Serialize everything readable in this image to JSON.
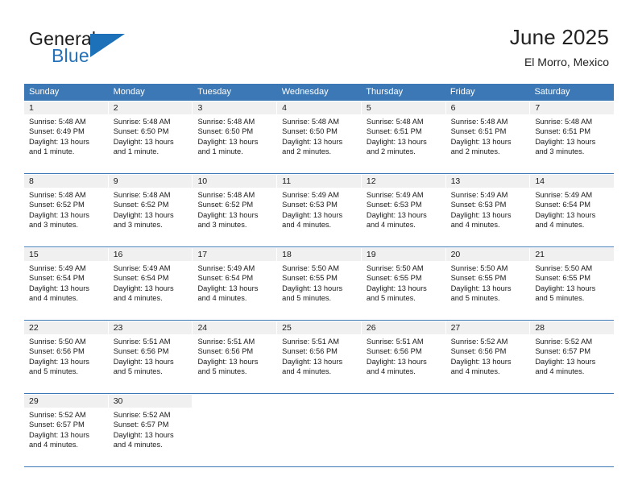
{
  "brand": {
    "word1": "General",
    "word2": "Blue",
    "triangle_color": "#1d71b8",
    "word1_color": "#1a1a1a",
    "word2_color": "#2572b8",
    "icon": "triangle-right-icon"
  },
  "header": {
    "title": "June 2025",
    "subtitle": "El Morro, Mexico"
  },
  "theme": {
    "header_blue": "#3b78b5",
    "daynum_bg": "#f0f0f0",
    "text": "#1a1a1a"
  },
  "weekdays": [
    "Sunday",
    "Monday",
    "Tuesday",
    "Wednesday",
    "Thursday",
    "Friday",
    "Saturday"
  ],
  "labels": {
    "sunrise": "Sunrise:",
    "sunset": "Sunset:",
    "daylight": "Daylight:"
  },
  "weeks": [
    [
      {
        "day": "1",
        "sunrise": "Sunrise: 5:48 AM",
        "sunset": "Sunset: 6:49 PM",
        "daylight_l1": "Daylight: 13 hours",
        "daylight_l2": "and 1 minute."
      },
      {
        "day": "2",
        "sunrise": "Sunrise: 5:48 AM",
        "sunset": "Sunset: 6:50 PM",
        "daylight_l1": "Daylight: 13 hours",
        "daylight_l2": "and 1 minute."
      },
      {
        "day": "3",
        "sunrise": "Sunrise: 5:48 AM",
        "sunset": "Sunset: 6:50 PM",
        "daylight_l1": "Daylight: 13 hours",
        "daylight_l2": "and 1 minute."
      },
      {
        "day": "4",
        "sunrise": "Sunrise: 5:48 AM",
        "sunset": "Sunset: 6:50 PM",
        "daylight_l1": "Daylight: 13 hours",
        "daylight_l2": "and 2 minutes."
      },
      {
        "day": "5",
        "sunrise": "Sunrise: 5:48 AM",
        "sunset": "Sunset: 6:51 PM",
        "daylight_l1": "Daylight: 13 hours",
        "daylight_l2": "and 2 minutes."
      },
      {
        "day": "6",
        "sunrise": "Sunrise: 5:48 AM",
        "sunset": "Sunset: 6:51 PM",
        "daylight_l1": "Daylight: 13 hours",
        "daylight_l2": "and 2 minutes."
      },
      {
        "day": "7",
        "sunrise": "Sunrise: 5:48 AM",
        "sunset": "Sunset: 6:51 PM",
        "daylight_l1": "Daylight: 13 hours",
        "daylight_l2": "and 3 minutes."
      }
    ],
    [
      {
        "day": "8",
        "sunrise": "Sunrise: 5:48 AM",
        "sunset": "Sunset: 6:52 PM",
        "daylight_l1": "Daylight: 13 hours",
        "daylight_l2": "and 3 minutes."
      },
      {
        "day": "9",
        "sunrise": "Sunrise: 5:48 AM",
        "sunset": "Sunset: 6:52 PM",
        "daylight_l1": "Daylight: 13 hours",
        "daylight_l2": "and 3 minutes."
      },
      {
        "day": "10",
        "sunrise": "Sunrise: 5:48 AM",
        "sunset": "Sunset: 6:52 PM",
        "daylight_l1": "Daylight: 13 hours",
        "daylight_l2": "and 3 minutes."
      },
      {
        "day": "11",
        "sunrise": "Sunrise: 5:49 AM",
        "sunset": "Sunset: 6:53 PM",
        "daylight_l1": "Daylight: 13 hours",
        "daylight_l2": "and 4 minutes."
      },
      {
        "day": "12",
        "sunrise": "Sunrise: 5:49 AM",
        "sunset": "Sunset: 6:53 PM",
        "daylight_l1": "Daylight: 13 hours",
        "daylight_l2": "and 4 minutes."
      },
      {
        "day": "13",
        "sunrise": "Sunrise: 5:49 AM",
        "sunset": "Sunset: 6:53 PM",
        "daylight_l1": "Daylight: 13 hours",
        "daylight_l2": "and 4 minutes."
      },
      {
        "day": "14",
        "sunrise": "Sunrise: 5:49 AM",
        "sunset": "Sunset: 6:54 PM",
        "daylight_l1": "Daylight: 13 hours",
        "daylight_l2": "and 4 minutes."
      }
    ],
    [
      {
        "day": "15",
        "sunrise": "Sunrise: 5:49 AM",
        "sunset": "Sunset: 6:54 PM",
        "daylight_l1": "Daylight: 13 hours",
        "daylight_l2": "and 4 minutes."
      },
      {
        "day": "16",
        "sunrise": "Sunrise: 5:49 AM",
        "sunset": "Sunset: 6:54 PM",
        "daylight_l1": "Daylight: 13 hours",
        "daylight_l2": "and 4 minutes."
      },
      {
        "day": "17",
        "sunrise": "Sunrise: 5:49 AM",
        "sunset": "Sunset: 6:54 PM",
        "daylight_l1": "Daylight: 13 hours",
        "daylight_l2": "and 4 minutes."
      },
      {
        "day": "18",
        "sunrise": "Sunrise: 5:50 AM",
        "sunset": "Sunset: 6:55 PM",
        "daylight_l1": "Daylight: 13 hours",
        "daylight_l2": "and 5 minutes."
      },
      {
        "day": "19",
        "sunrise": "Sunrise: 5:50 AM",
        "sunset": "Sunset: 6:55 PM",
        "daylight_l1": "Daylight: 13 hours",
        "daylight_l2": "and 5 minutes."
      },
      {
        "day": "20",
        "sunrise": "Sunrise: 5:50 AM",
        "sunset": "Sunset: 6:55 PM",
        "daylight_l1": "Daylight: 13 hours",
        "daylight_l2": "and 5 minutes."
      },
      {
        "day": "21",
        "sunrise": "Sunrise: 5:50 AM",
        "sunset": "Sunset: 6:55 PM",
        "daylight_l1": "Daylight: 13 hours",
        "daylight_l2": "and 5 minutes."
      }
    ],
    [
      {
        "day": "22",
        "sunrise": "Sunrise: 5:50 AM",
        "sunset": "Sunset: 6:56 PM",
        "daylight_l1": "Daylight: 13 hours",
        "daylight_l2": "and 5 minutes."
      },
      {
        "day": "23",
        "sunrise": "Sunrise: 5:51 AM",
        "sunset": "Sunset: 6:56 PM",
        "daylight_l1": "Daylight: 13 hours",
        "daylight_l2": "and 5 minutes."
      },
      {
        "day": "24",
        "sunrise": "Sunrise: 5:51 AM",
        "sunset": "Sunset: 6:56 PM",
        "daylight_l1": "Daylight: 13 hours",
        "daylight_l2": "and 5 minutes."
      },
      {
        "day": "25",
        "sunrise": "Sunrise: 5:51 AM",
        "sunset": "Sunset: 6:56 PM",
        "daylight_l1": "Daylight: 13 hours",
        "daylight_l2": "and 4 minutes."
      },
      {
        "day": "26",
        "sunrise": "Sunrise: 5:51 AM",
        "sunset": "Sunset: 6:56 PM",
        "daylight_l1": "Daylight: 13 hours",
        "daylight_l2": "and 4 minutes."
      },
      {
        "day": "27",
        "sunrise": "Sunrise: 5:52 AM",
        "sunset": "Sunset: 6:56 PM",
        "daylight_l1": "Daylight: 13 hours",
        "daylight_l2": "and 4 minutes."
      },
      {
        "day": "28",
        "sunrise": "Sunrise: 5:52 AM",
        "sunset": "Sunset: 6:57 PM",
        "daylight_l1": "Daylight: 13 hours",
        "daylight_l2": "and 4 minutes."
      }
    ],
    [
      {
        "day": "29",
        "sunrise": "Sunrise: 5:52 AM",
        "sunset": "Sunset: 6:57 PM",
        "daylight_l1": "Daylight: 13 hours",
        "daylight_l2": "and 4 minutes."
      },
      {
        "day": "30",
        "sunrise": "Sunrise: 5:52 AM",
        "sunset": "Sunset: 6:57 PM",
        "daylight_l1": "Daylight: 13 hours",
        "daylight_l2": "and 4 minutes."
      },
      {
        "day": "",
        "sunrise": "",
        "sunset": "",
        "daylight_l1": "",
        "daylight_l2": ""
      },
      {
        "day": "",
        "sunrise": "",
        "sunset": "",
        "daylight_l1": "",
        "daylight_l2": ""
      },
      {
        "day": "",
        "sunrise": "",
        "sunset": "",
        "daylight_l1": "",
        "daylight_l2": ""
      },
      {
        "day": "",
        "sunrise": "",
        "sunset": "",
        "daylight_l1": "",
        "daylight_l2": ""
      },
      {
        "day": "",
        "sunrise": "",
        "sunset": "",
        "daylight_l1": "",
        "daylight_l2": ""
      }
    ]
  ]
}
